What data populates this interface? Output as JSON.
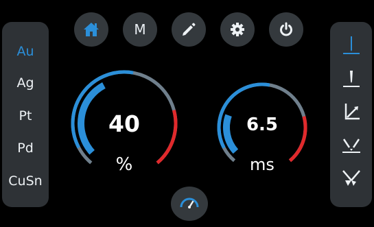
{
  "nav": {
    "home_icon": "home-icon",
    "memory_label": "M",
    "edit_icon": "pencil-icon",
    "settings_icon": "gear-icon",
    "power_icon": "power-icon"
  },
  "metals": {
    "items": [
      "Au",
      "Ag",
      "Pt",
      "Pd",
      "CuSn"
    ],
    "selected": "Au"
  },
  "modes": {
    "items": [
      "mode-1-icon",
      "mode-2-icon",
      "mode-3-icon",
      "mode-4-icon",
      "mode-5-icon"
    ],
    "selected_index": 0
  },
  "gauges": {
    "power": {
      "value": "40",
      "unit": "%",
      "level": 0.4
    },
    "duration": {
      "value": "6.5",
      "unit": "ms",
      "level": 0.25
    }
  },
  "bottom": {
    "icon": "speedometer-icon"
  },
  "colors": {
    "accent": "#2b8fd9",
    "danger": "#e0292b",
    "track": "#6f7f8c",
    "button": "#34393d",
    "panel": "#2e3236"
  }
}
